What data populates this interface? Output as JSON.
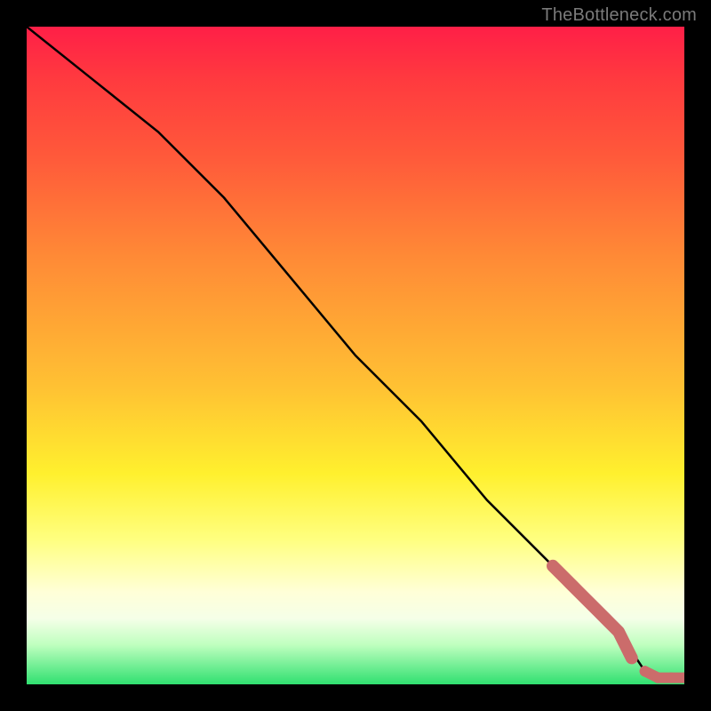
{
  "attribution": "TheBottleneck.com",
  "chart_data": {
    "type": "line",
    "title": "",
    "xlabel": "",
    "ylabel": "",
    "xlim": [
      0,
      100
    ],
    "ylim": [
      0,
      100
    ],
    "x": [
      0,
      10,
      20,
      30,
      35,
      40,
      50,
      60,
      70,
      80,
      85,
      88,
      90,
      92,
      94,
      96,
      98,
      100
    ],
    "y": [
      100,
      92,
      84,
      74,
      68,
      62,
      50,
      40,
      28,
      18,
      13,
      10,
      8,
      5,
      2,
      1,
      1,
      1
    ],
    "series": [
      {
        "name": "curve",
        "x": [
          0,
          10,
          20,
          30,
          35,
          40,
          50,
          60,
          70,
          80,
          85,
          88,
          90,
          92,
          94,
          96,
          98,
          100
        ],
        "y": [
          100,
          92,
          84,
          74,
          68,
          62,
          50,
          40,
          28,
          18,
          13,
          10,
          8,
          5,
          2,
          1,
          1,
          1
        ]
      },
      {
        "name": "highlight_points",
        "x": [
          80,
          82,
          83,
          84,
          85,
          86,
          87,
          88,
          89,
          90,
          92,
          94,
          96,
          98,
          100
        ],
        "y": [
          18,
          16,
          15,
          14,
          13,
          12,
          11,
          10,
          9,
          8,
          4,
          2,
          1,
          1,
          1
        ]
      }
    ],
    "colors": {
      "line": "#000000",
      "highlight": "#cb6c6b",
      "gradient_top": "#ff1f47",
      "gradient_bottom": "#30e070"
    }
  }
}
